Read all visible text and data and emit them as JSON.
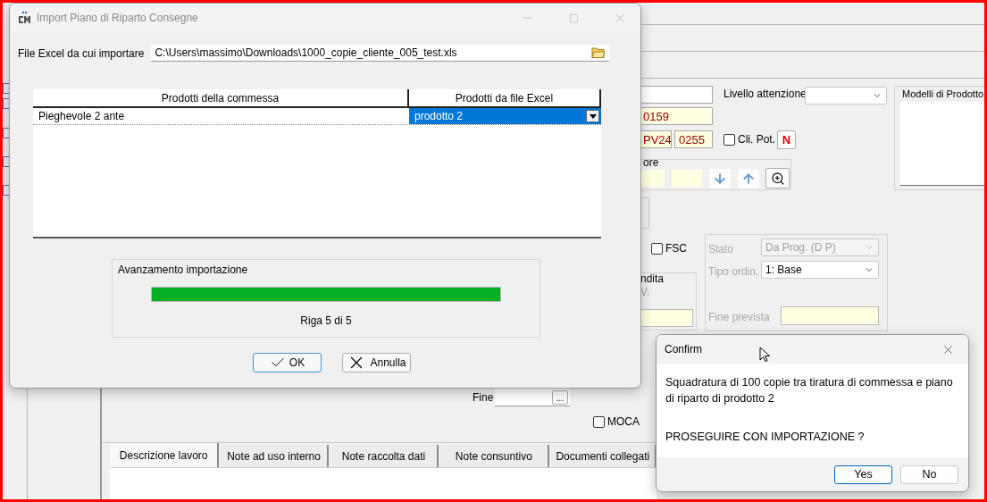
{
  "background_form": {
    "attention_label": "Livello attenzione",
    "product_models_title": "Modelli di Prodotto",
    "code_fields": [
      "0159",
      "PV24",
      "0255"
    ],
    "potential_client": {
      "label": "Cli. Pot.",
      "checked": false
    },
    "new_badge": "N",
    "search_group_title": "ore",
    "fsc": {
      "label": "FSC",
      "checked": false
    },
    "state_label": "Stato",
    "state_value": "Da Prog. (D P)",
    "order_type_label": "Tipo ordin.",
    "order_type_value": "1: Base",
    "sale_group_title": "ndita",
    "sale_label": "V.",
    "end_forecast_label": "Fine prevista",
    "end_label": "Fine",
    "date_button": "...",
    "moca": {
      "label": "MOCA",
      "checked": false
    },
    "tabs": [
      {
        "label": "Descrizione lavoro",
        "selected": true
      },
      {
        "label": "Note ad uso interno",
        "selected": false
      },
      {
        "label": "Note raccolta dati",
        "selected": false
      },
      {
        "label": "Note consuntivo",
        "selected": false
      },
      {
        "label": "Documenti collegati",
        "selected": false
      }
    ]
  },
  "import_dialog": {
    "title": "Import Piano di Riparto Consegne",
    "file_label": "File Excel da cui importare",
    "file_path": "C:\\Users\\massimo\\Downloads\\1000_copie_cliente_005_test.xls",
    "table": {
      "columns": [
        "Prodotti della commessa",
        "Prodotti da file Excel"
      ],
      "rows": [
        {
          "product": "Pieghevole 2 ante",
          "excel_product": "prodotto 2",
          "selected": true
        }
      ]
    },
    "progress": {
      "title": "Avanzamento importazione",
      "level": 1,
      "reading": "Riga 5 di 5"
    },
    "buttons": [
      {
        "kind": "ok",
        "label": "OK",
        "default": true
      },
      {
        "kind": "cancel",
        "label": "Annulla",
        "default": false
      }
    ]
  },
  "confirm_dialog": {
    "title": "Confirm",
    "message": "Squadratura di 100 copie tra tiratura di commessa e piano di riparto di prodotto 2",
    "question": "PROSEGUIRE CON IMPORTAZIONE ?",
    "buttons": [
      {
        "label": "Yes",
        "default": true
      },
      {
        "label": "No",
        "default": false
      }
    ]
  }
}
